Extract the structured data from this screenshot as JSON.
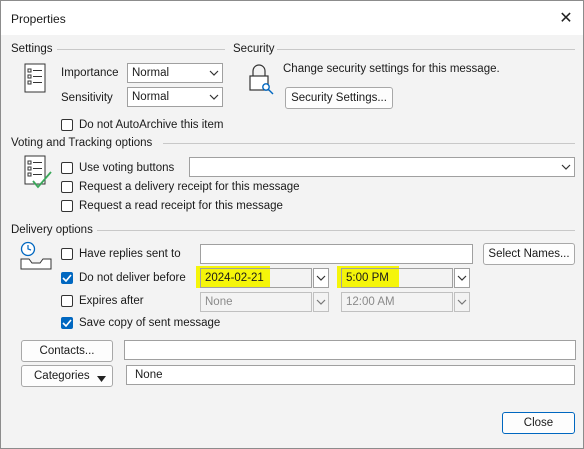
{
  "window": {
    "title": "Properties",
    "close_glyph": "✕"
  },
  "settings": {
    "heading": "Settings",
    "importance_label": "Importance",
    "importance_value": "Normal",
    "sensitivity_label": "Sensitivity",
    "sensitivity_value": "Normal",
    "autoarchive_label": "Do not AutoArchive this item",
    "autoarchive_checked": false
  },
  "security": {
    "heading": "Security",
    "description": "Change security settings for this message.",
    "button_label": "Security Settings..."
  },
  "voting": {
    "heading": "Voting and Tracking options",
    "use_voting_label": "Use voting buttons",
    "use_voting_value": "",
    "delivery_receipt_label": "Request a delivery receipt for this message",
    "read_receipt_label": "Request a read receipt for this message"
  },
  "delivery": {
    "heading": "Delivery options",
    "replies_label": "Have replies sent to",
    "replies_value": "",
    "select_names_label": "Select Names...",
    "do_not_deliver_label": "Do not deliver before",
    "do_not_deliver_checked": true,
    "do_not_deliver_date": "2024-02-21",
    "do_not_deliver_time": "5:00 PM",
    "expires_label": "Expires after",
    "expires_checked": false,
    "expires_date": "None",
    "expires_time": "12:00 AM",
    "save_copy_label": "Save copy of sent message",
    "save_copy_checked": true
  },
  "contacts": {
    "button_label": "Contacts...",
    "value": ""
  },
  "categories": {
    "button_label": "Categories",
    "value": "None"
  },
  "footer": {
    "close_label": "Close"
  },
  "colors": {
    "accent": "#0067c0",
    "highlight": "#f5f50a"
  }
}
